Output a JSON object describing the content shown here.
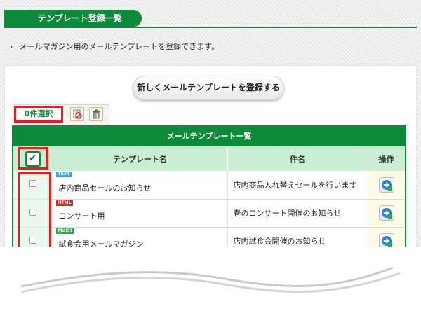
{
  "header": {
    "title": "テンプレート登録一覧"
  },
  "breadcrumb": {
    "chevron": "›",
    "text": "メールマガジン用のメールテンプレートを登録できます。"
  },
  "actions": {
    "register_label": "新しくメールテンプレートを登録する"
  },
  "toolbar": {
    "selected_count": "0件選択",
    "icons": [
      "delete-schedule-icon",
      "trash-icon"
    ]
  },
  "table": {
    "title": "メールテンプレート一覧",
    "columns": {
      "check": "✔",
      "name": "テンプレート名",
      "subject": "件名",
      "ops": "操作"
    },
    "rows": [
      {
        "type": "TEXT",
        "name": "店内商品セールのお知らせ",
        "subject": "店内商品入れ替えセールを行います"
      },
      {
        "type": "HTML",
        "name": "コンサート用",
        "subject": "春のコンサート開催のお知らせ"
      },
      {
        "type": "MULTI",
        "name": "試食会用メールマガジン",
        "subject": "店内試食会開催のお知らせ"
      }
    ]
  },
  "colors": {
    "brand_green": "#0d8a3a",
    "header_light_green": "#c9eed4",
    "highlight_red": "#e02020",
    "tag_text": "#43a3d9",
    "tag_html": "#e02020",
    "tag_multi": "#2da84a"
  }
}
